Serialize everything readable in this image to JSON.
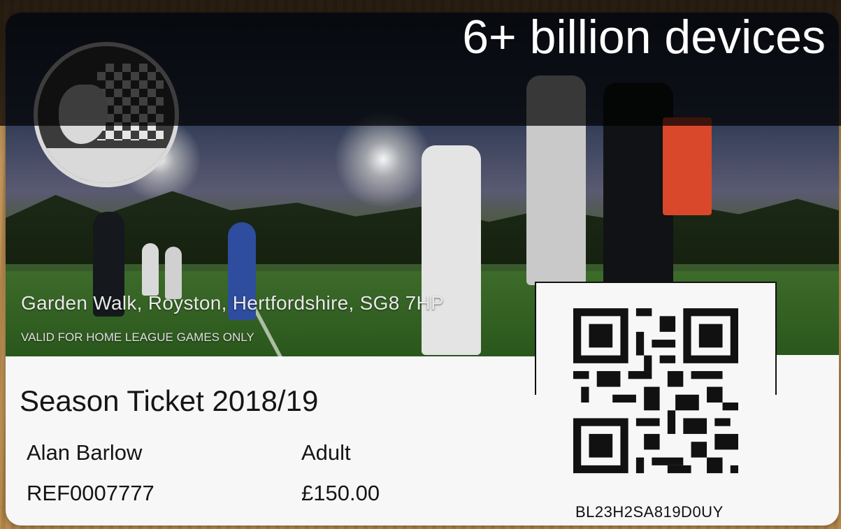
{
  "banner": {
    "text": "6+ billion devices"
  },
  "ticket": {
    "address": "Garden Walk, Royston, Hertfordshire, SG8 7HP",
    "validity": "VALID FOR HOME LEAGUE GAMES ONLY",
    "title": "Season Ticket 2018/19",
    "holder_name": "Alan Barlow",
    "reference": "REF0007777",
    "ticket_type": "Adult",
    "price": "£150.00",
    "qr_code_text": "BL23H2SA819D0UY"
  },
  "colors": {
    "card": "#f7f7f7",
    "text": "#151515",
    "banner_overlay": "#000000"
  },
  "icons": [
    "club-crest-logo",
    "qr-code"
  ]
}
